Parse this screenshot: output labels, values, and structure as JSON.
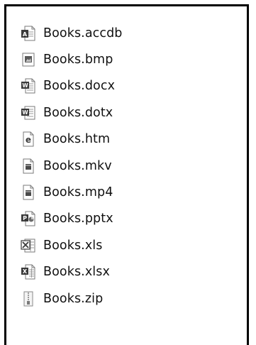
{
  "file_list": {
    "items": [
      {
        "name": "Books.accdb",
        "icon": "access-file-icon",
        "badge": "A",
        "color": "#a4373a"
      },
      {
        "name": "Books.bmp",
        "icon": "bitmap-image-file-icon",
        "badge": "",
        "color": "#4a4a4a"
      },
      {
        "name": "Books.docx",
        "icon": "word-document-file-icon",
        "badge": "W",
        "color": "#2b579a"
      },
      {
        "name": "Books.dotx",
        "icon": "word-template-file-icon",
        "badge": "W",
        "color": "#2b579a"
      },
      {
        "name": "Books.htm",
        "icon": "html-file-icon",
        "badge": "e",
        "color": "#1e6bb8"
      },
      {
        "name": "Books.mkv",
        "icon": "video-file-icon",
        "badge": "",
        "color": "#4a4a4a"
      },
      {
        "name": "Books.mp4",
        "icon": "video-file-icon",
        "badge": "",
        "color": "#4a4a4a"
      },
      {
        "name": "Books.pptx",
        "icon": "powerpoint-file-icon",
        "badge": "P",
        "color": "#b7472a"
      },
      {
        "name": "Books.xls",
        "icon": "excel-legacy-file-icon",
        "badge": "X",
        "color": "#217346"
      },
      {
        "name": "Books.xlsx",
        "icon": "excel-file-icon",
        "badge": "X",
        "color": "#217346"
      },
      {
        "name": "Books.zip",
        "icon": "zip-archive-file-icon",
        "badge": "",
        "color": "#8a8a8a"
      }
    ]
  }
}
